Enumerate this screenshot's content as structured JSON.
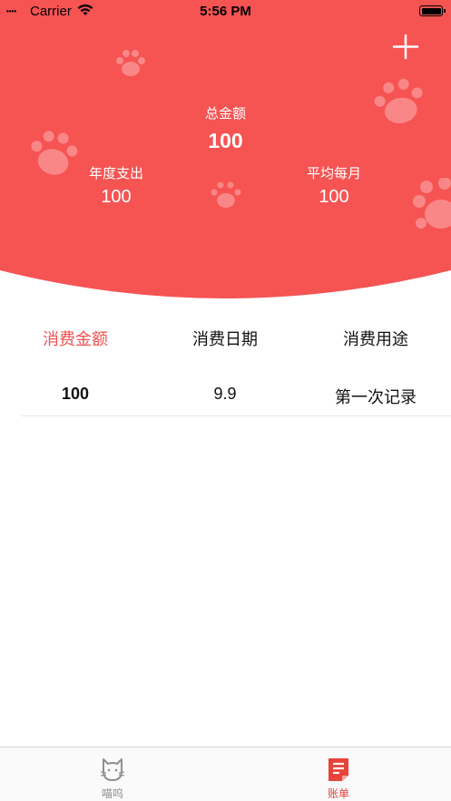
{
  "status_bar": {
    "signal": "••••",
    "carrier": "Carrier",
    "time": "5:56 PM"
  },
  "header": {
    "background_color": "#f65353",
    "add_icon": "plus-icon",
    "total_label": "总金额",
    "total_value": "100",
    "yearly_label": "年度支出",
    "yearly_value": "100",
    "monthly_label": "平均每月",
    "monthly_value": "100"
  },
  "table": {
    "columns": [
      "消费金额",
      "消费日期",
      "消费用途"
    ],
    "active_column": 0,
    "active_color": "#f05050",
    "rows": [
      {
        "amount": "100",
        "date": "9.9",
        "purpose": "第一次记录"
      }
    ]
  },
  "tab_bar": {
    "tabs": [
      {
        "label": "喵呜",
        "icon": "cat-icon",
        "selected": false
      },
      {
        "label": "账单",
        "icon": "bill-icon",
        "selected": true
      }
    ],
    "selected_color": "#e8433b",
    "unselected_color": "#8e8e8e"
  }
}
